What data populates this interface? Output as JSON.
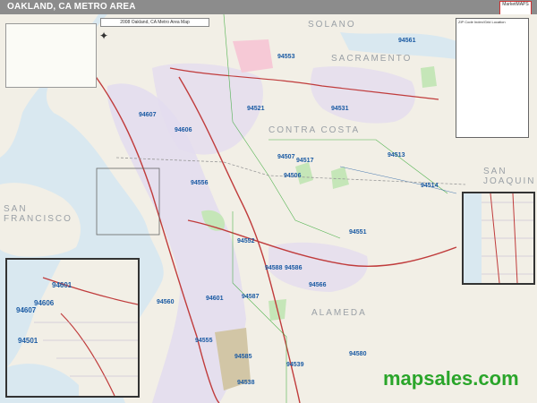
{
  "header": {
    "title": "OAKLAND, CA METRO AREA",
    "logo_text": "MarketMAPS"
  },
  "legend": {
    "title": "",
    "map_title_box": "2008 Oakland, CA Metro Area Map"
  },
  "index_box": {
    "title": "ZIP Code Index/Grid Location"
  },
  "regions": {
    "solano": "SOLANO",
    "sacramento": "SACRAMENTO",
    "contra_costa": "CONTRA COSTA",
    "san_joaquin": "SAN JOAQUIN",
    "san_francisco": "SAN FRANCISCO",
    "alameda": "ALAMEDA"
  },
  "zip_labels": [
    "94561",
    "94553",
    "94531",
    "94521",
    "94507",
    "94506",
    "94556",
    "94517",
    "94513",
    "94514",
    "94551",
    "94552",
    "94588",
    "94586",
    "94566",
    "94587",
    "94555",
    "94538",
    "94539",
    "94560",
    "94601",
    "94607",
    "94606",
    "94580",
    "94585"
  ],
  "inset_left_zips": [
    "94601",
    "94607",
    "94606",
    "94501"
  ],
  "brand": "mapsales.com",
  "colors": {
    "water": "#d9e8f0",
    "land": "#f2efe6",
    "urban": "#e3dcef",
    "park": "#c5e6b8",
    "pink": "#f6c9d6",
    "highway": "#c03c3c",
    "brand_green": "#2aa52a",
    "title_bar": "#8c8c8c"
  }
}
